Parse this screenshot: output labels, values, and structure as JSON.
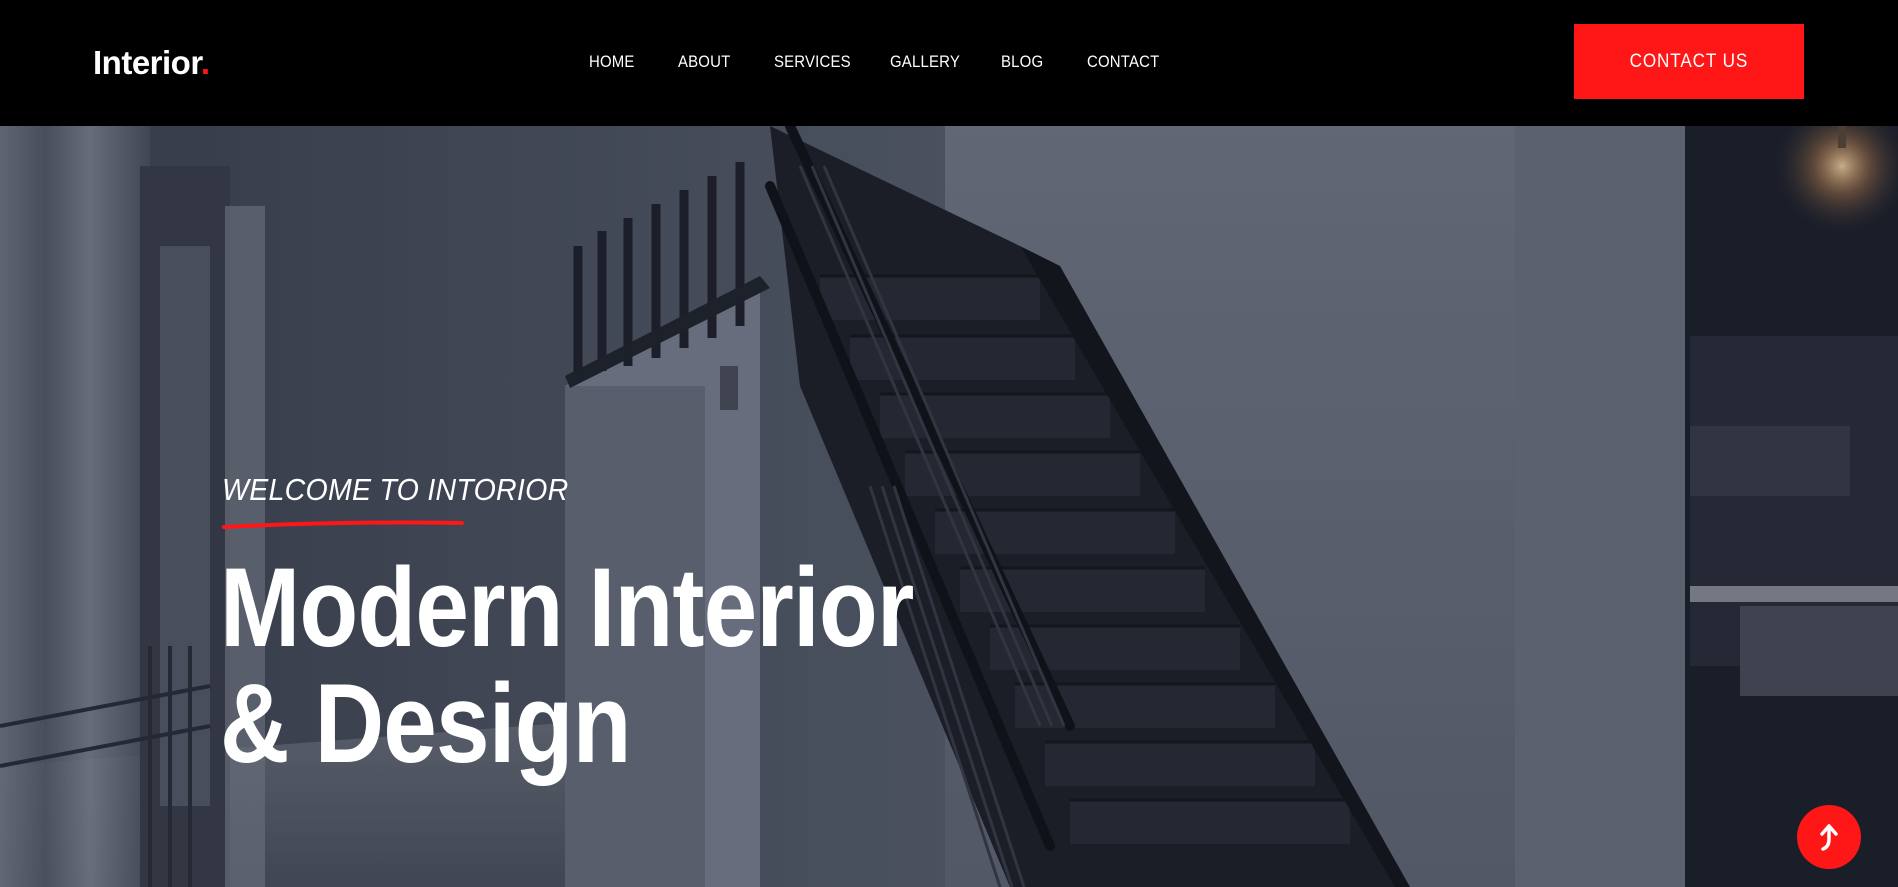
{
  "brand": {
    "name": "Interior",
    "dot": "."
  },
  "nav": {
    "items": [
      {
        "label": "HOME"
      },
      {
        "label": "ABOUT"
      },
      {
        "label": "SERVICES"
      },
      {
        "label": "GALLERY"
      },
      {
        "label": "BLOG"
      },
      {
        "label": "CONTACT"
      }
    ],
    "cta_label": "CONTACT US"
  },
  "hero": {
    "eyebrow": "WELCOME TO INTORIOR",
    "title_line1": "Modern Interior",
    "title_line2": "& Design",
    "background_image": "staircase-interior-photo"
  },
  "scroll_top": {
    "icon": "arrow-up-icon"
  },
  "colors": {
    "accent": "#ff1616",
    "header_bg": "#000000",
    "text": "#ffffff"
  }
}
